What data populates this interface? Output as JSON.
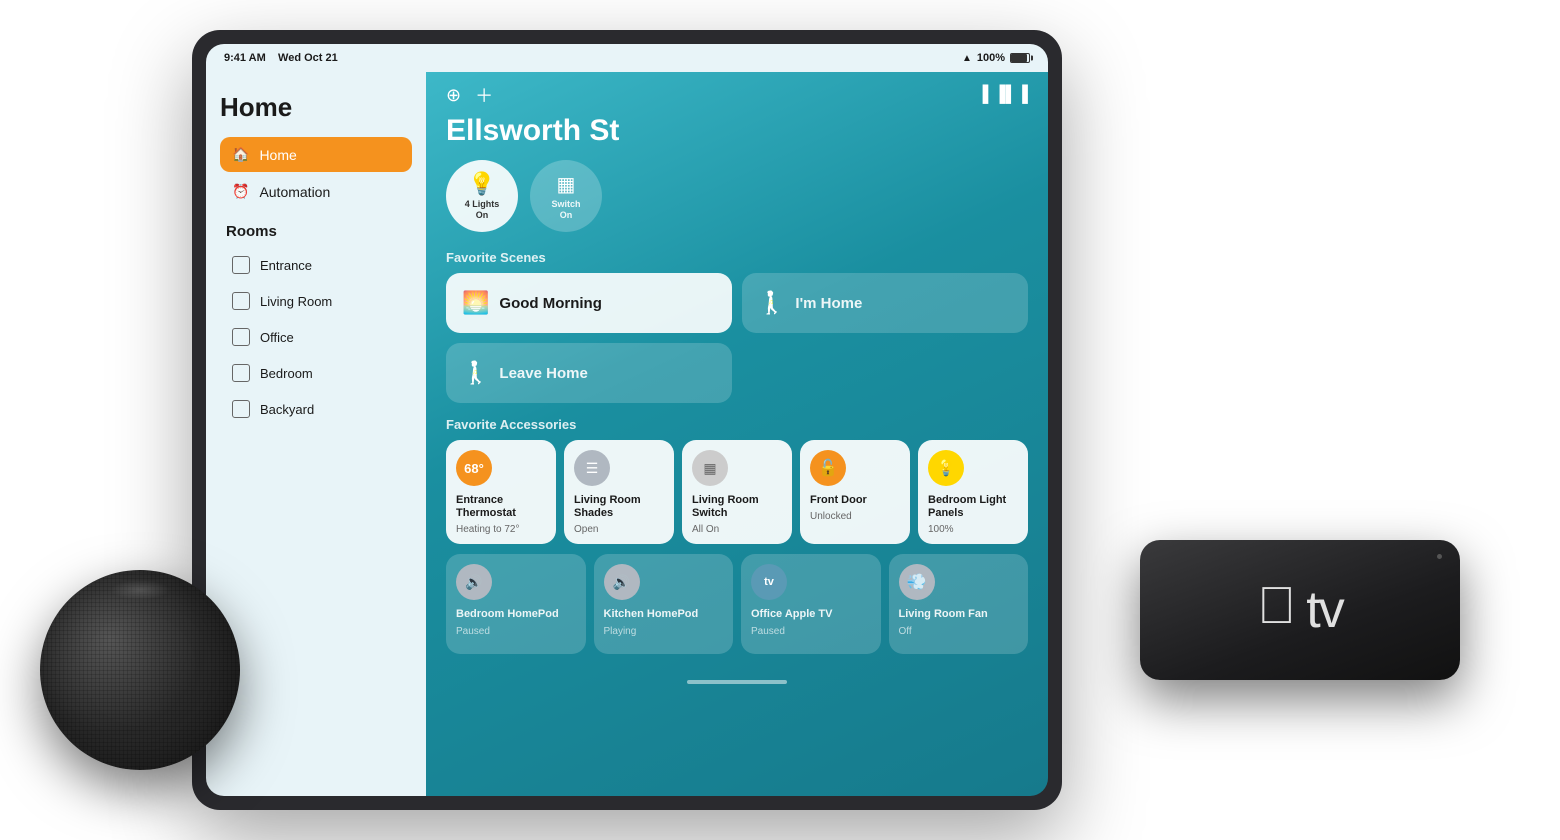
{
  "statusBar": {
    "time": "9:41 AM",
    "date": "Wed Oct 21",
    "wifi": "WiFi",
    "battery": "100%"
  },
  "sidebar": {
    "title": "Home",
    "navItems": [
      {
        "id": "home",
        "label": "Home",
        "icon": "🏠",
        "active": true
      },
      {
        "id": "automation",
        "label": "Automation",
        "icon": "⏰",
        "active": false
      }
    ],
    "roomsTitle": "Rooms",
    "rooms": [
      {
        "id": "entrance",
        "label": "Entrance"
      },
      {
        "id": "living-room",
        "label": "Living Room"
      },
      {
        "id": "office",
        "label": "Office"
      },
      {
        "id": "bedroom",
        "label": "Bedroom"
      },
      {
        "id": "backyard",
        "label": "Backyard"
      }
    ]
  },
  "main": {
    "locationTitle": "Ellsworth St",
    "quickTiles": [
      {
        "id": "lights",
        "label": "4 Lights\nOn",
        "icon": "💡",
        "active": true
      },
      {
        "id": "switch",
        "label": "Switch\nOn",
        "icon": "⬛",
        "active": false
      }
    ],
    "scenesLabel": "Favorite Scenes",
    "scenes": [
      {
        "id": "good-morning",
        "label": "Good Morning",
        "icon": "🌅",
        "active": true
      },
      {
        "id": "im-home",
        "label": "I'm Home",
        "icon": "🚶",
        "active": false
      },
      {
        "id": "leave-home",
        "label": "Leave Home",
        "icon": "🚶",
        "active": false
      }
    ],
    "accessoriesLabel": "Favorite Accessories",
    "accessoriesRow1": [
      {
        "id": "entrance-thermostat",
        "name": "Entrance Thermostat",
        "status": "Heating to 72°",
        "icon": "🌡️",
        "iconBg": "orange",
        "tempBadge": "68°"
      },
      {
        "id": "living-room-shades",
        "name": "Living Room Shades",
        "status": "Open",
        "icon": "☰",
        "iconBg": "gray"
      },
      {
        "id": "living-room-switch",
        "name": "Living Room Switch",
        "status": "All On",
        "icon": "⬜",
        "iconBg": "gray"
      },
      {
        "id": "front-door",
        "name": "Front Door",
        "status": "Unlocked",
        "icon": "🔓",
        "iconBg": "orange"
      },
      {
        "id": "bedroom-light-panels",
        "name": "Bedroom Light Panels",
        "status": "100%",
        "icon": "💡",
        "iconBg": "yellow"
      }
    ],
    "accessoriesRow2": [
      {
        "id": "bedroom-homepod",
        "name": "Bedroom HomePod",
        "status": "Paused",
        "icon": "🔊",
        "iconBg": "gray"
      },
      {
        "id": "kitchen-homepod",
        "name": "Kitchen HomePod",
        "status": "Playing",
        "icon": "🔊",
        "iconBg": "gray"
      },
      {
        "id": "office-apple-tv",
        "name": "Office Apple TV",
        "status": "Paused",
        "icon": "📺",
        "iconBg": "blue"
      },
      {
        "id": "living-room-fan",
        "name": "Living Room Fan",
        "status": "Off",
        "icon": "💨",
        "iconBg": "gray"
      }
    ]
  }
}
